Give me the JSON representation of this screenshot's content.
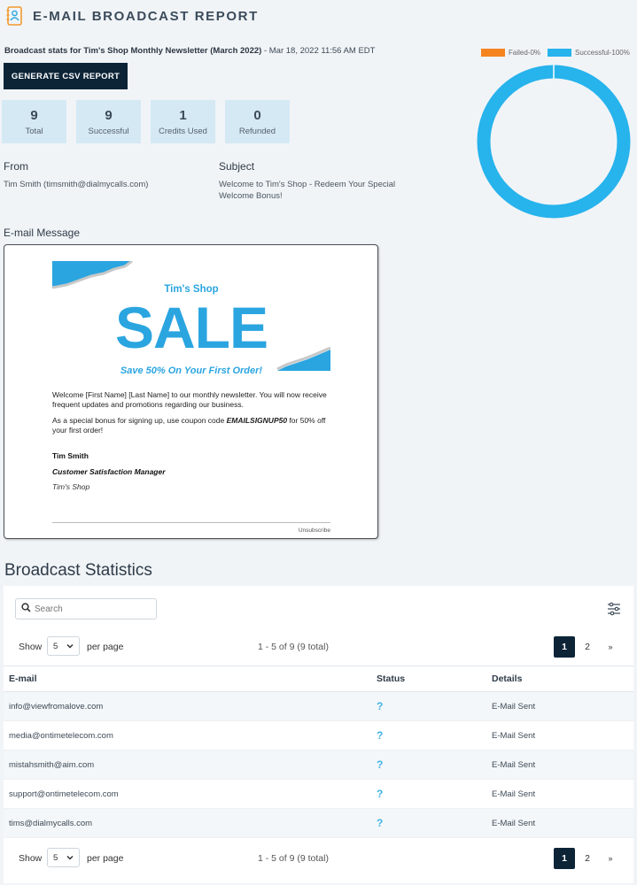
{
  "header": {
    "title": "E-MAIL BROADCAST REPORT",
    "icon": "contact-book-icon"
  },
  "broadcast": {
    "stats_prefix": "Broadcast stats for Tim's Shop Monthly Newsletter (March 2022)",
    "timestamp": " - Mar 18, 2022 11:56 AM EDT"
  },
  "csv_button": "GENERATE CSV REPORT",
  "stats": [
    {
      "value": "9",
      "label": "Total"
    },
    {
      "value": "9",
      "label": "Successful"
    },
    {
      "value": "1",
      "label": "Credits Used"
    },
    {
      "value": "0",
      "label": "Refunded"
    }
  ],
  "from": {
    "label": "From",
    "value": "Tim Smith (timsmith@dialmycalls.com)"
  },
  "subject": {
    "label": "Subject",
    "value": "Welcome to Tim's Shop - Redeem Your Special Welcome Bonus!"
  },
  "email_message_label": "E-mail Message",
  "chart_data": {
    "type": "pie",
    "donut": true,
    "categories": [
      "Failed-0%",
      "Successful-100%"
    ],
    "values": [
      0,
      100
    ],
    "colors": [
      "#f5841f",
      "#27b3ec"
    ],
    "legend": "top"
  },
  "email": {
    "shop_name": "Tim's Shop",
    "sale": "SALE",
    "save_line": "Save 50% On Your First Order!",
    "paragraph1": "Welcome [First Name] [Last Name] to our monthly newsletter. You will now receive frequent updates  and promotions regarding our business.",
    "paragraph2_prefix": "As a special bonus for signing up, use coupon code ",
    "coupon": "EMAILSIGNUP50",
    "paragraph2_suffix": " for 50% off your first order!",
    "sig_name": "Tim Smith",
    "sig_role": "Customer Satisfaction Manager",
    "sig_shop": "Tim's Shop",
    "unsubscribe": "Unsubscribe"
  },
  "statistics": {
    "title": "Broadcast Statistics",
    "search_placeholder": "Search",
    "show_label": "Show",
    "per_page_value": "5",
    "per_page_label": "per page",
    "count_text": "1 - 5 of 9 (9 total)",
    "pages": [
      "1",
      "2",
      "»"
    ],
    "columns": {
      "email": "E-mail",
      "status": "Status",
      "details": "Details"
    },
    "rows": [
      {
        "email": "info@viewfromalove.com",
        "status": "?",
        "details": "E-Mail Sent"
      },
      {
        "email": "media@ontimetelecom.com",
        "status": "?",
        "details": "E-Mail Sent"
      },
      {
        "email": "mistahsmith@aim.com",
        "status": "?",
        "details": "E-Mail Sent"
      },
      {
        "email": "support@ontimetelecom.com",
        "status": "?",
        "details": "E-Mail Sent"
      },
      {
        "email": "tims@dialmycalls.com",
        "status": "?",
        "details": "E-Mail Sent"
      }
    ]
  }
}
